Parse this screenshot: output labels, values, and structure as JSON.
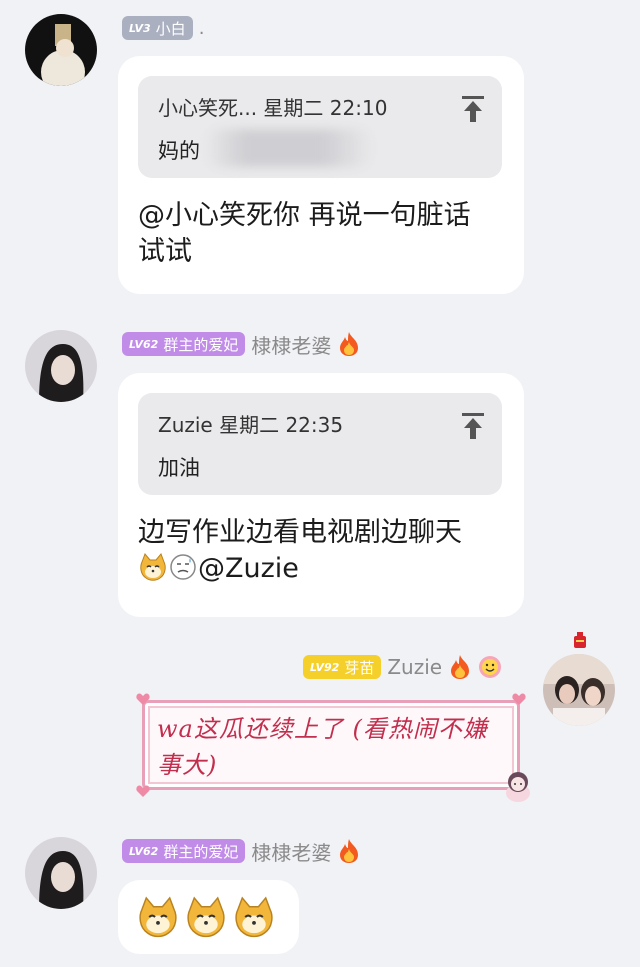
{
  "messages": [
    {
      "level": "LV3",
      "title": "小白",
      "trailing": ".",
      "quote": {
        "meta": "小心笑死... 星期二 22:10",
        "text": "妈的"
      },
      "text_lines": [
        "@小心笑死你 再说一句脏话",
        "试试"
      ]
    },
    {
      "level": "LV62",
      "title": "群主的爱妃",
      "nickname": "棣棣老婆",
      "quote": {
        "meta": "Zuzie 星期二 22:35",
        "text": "加油"
      },
      "text_line1": "边写作业边看电视剧边聊天",
      "text_line2_suffix": "@Zuzie"
    },
    {
      "level": "LV92",
      "title": "芽苗",
      "nickname": "Zuzie",
      "sticker_text": "wa这瓜还续上了 (看热闹不嫌事大)"
    },
    {
      "level": "LV62",
      "title": "群主的爱妃",
      "nickname": "棣棣老婆",
      "emoji_count": 3
    }
  ],
  "colors": {
    "bg": "#f1f2f6",
    "bubble": "#ffffff",
    "quote_bg": "#eaeaec",
    "badge_gray": "#aab0c0",
    "badge_purple": "#c08ce8",
    "badge_yellow": "#f5d02a"
  },
  "icons": [
    "pin-top-icon",
    "flame-icon",
    "dog-emoji-icon",
    "sweat-emoji-icon",
    "smile-emoji-icon"
  ]
}
